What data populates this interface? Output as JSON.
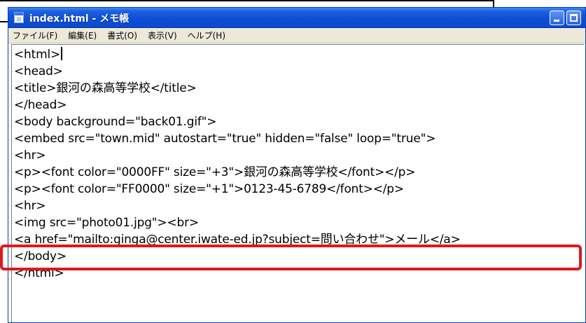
{
  "window": {
    "title": "index.html - メモ帳",
    "buttons": [
      "minimize",
      "maximize"
    ]
  },
  "menu": [
    "ファイル(F)",
    "編集(E)",
    "書式(O)",
    "表示(V)",
    "ヘルプ(H)"
  ],
  "editor": {
    "lines": [
      "<html>",
      "<head>",
      "<title>銀河の森高等学校</title>",
      "</head>",
      "<body background=\"back01.gif\">",
      "<embed src=\"town.mid\" autostart=\"true\" hidden=\"false\" loop=\"true\">",
      "<hr>",
      "<p><font color=\"0000FF\" size=\"+3\">銀河の森高等学校</font></p>",
      "<p><font color=\"FF0000\" size=\"+1\">0123-45-6789</font></p>",
      "<hr>",
      "<img src=\"photo01.jpg\"><br>",
      "<a href=\"mailto:ginga@center.iwate-ed.jp?subject=問い合わせ\">メール</a>",
      "</body>",
      "</html>"
    ],
    "highlighted_line_index": 11
  },
  "colors": {
    "titlebar": "#0a49cf",
    "menubar": "#ece9d8",
    "highlight": "#e01818"
  }
}
